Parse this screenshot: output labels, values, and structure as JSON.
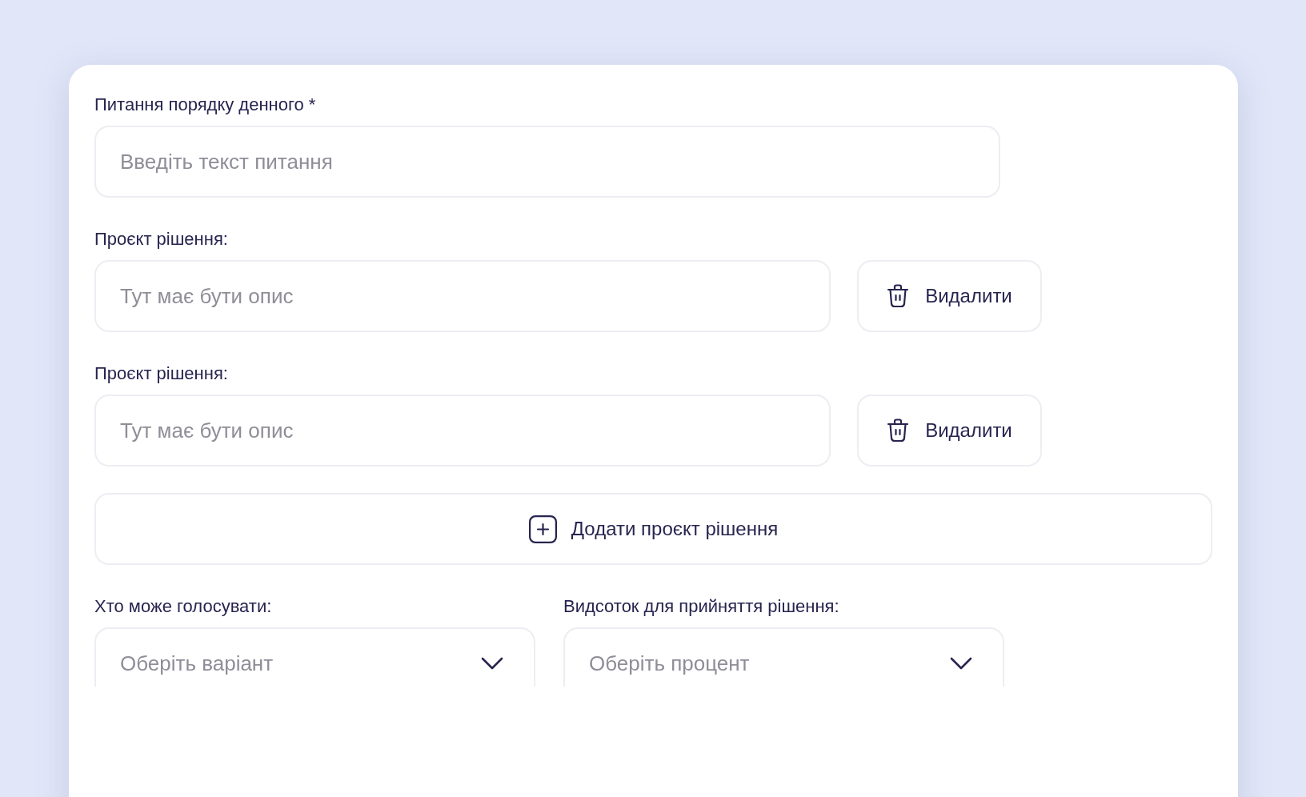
{
  "question": {
    "label": "Питання порядку денного *",
    "placeholder": "Введіть текст питання"
  },
  "drafts": [
    {
      "label": "Проєкт рішення:",
      "placeholder": "Тут має бути опис",
      "delete_button": "Видалити"
    },
    {
      "label": "Проєкт рішення:",
      "placeholder": "Тут має бути опис",
      "delete_button": "Видалити"
    }
  ],
  "add_button": "Додати проєкт рішення",
  "selects": [
    {
      "label": "Хто може голосувати:",
      "placeholder": "Оберіть варіант"
    },
    {
      "label": "Видсоток для прийняття рішення:",
      "placeholder": "Оберіть процент"
    }
  ]
}
